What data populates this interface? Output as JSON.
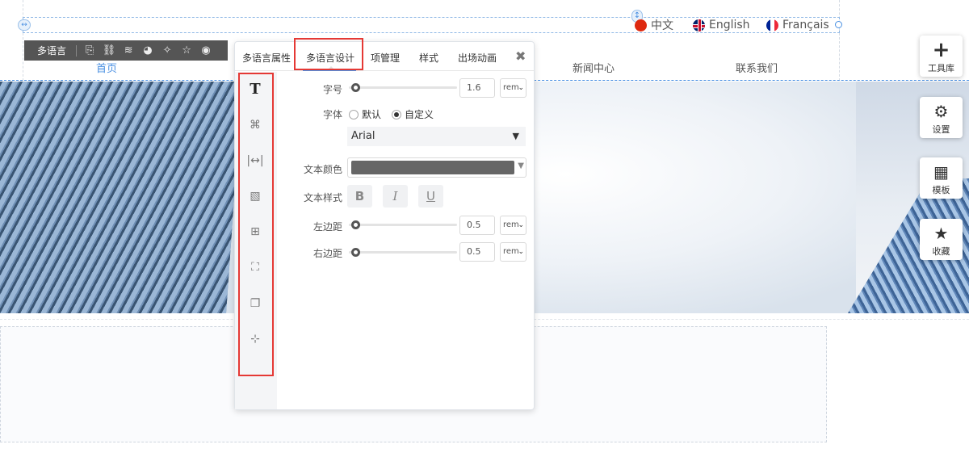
{
  "language_bar": {
    "languages": [
      {
        "label": "中文"
      },
      {
        "label": "English"
      },
      {
        "label": "Français"
      }
    ]
  },
  "nav": {
    "items": [
      "首页",
      "新闻中心",
      "联系我们"
    ]
  },
  "toolbar": {
    "label": "多语言",
    "icons": [
      "page-settings-icon",
      "unlink-icon",
      "layers-icon",
      "palette-icon",
      "magic-wand-icon",
      "star-icon",
      "eye-icon"
    ]
  },
  "panel": {
    "tabs": [
      "多语言属性",
      "多语言设计",
      "项管理",
      "样式",
      "出场动画"
    ],
    "active_tab": "多语言设计",
    "close_label": "✖",
    "side_icons": [
      "text-icon",
      "command-icon",
      "width-icon",
      "pattern-icon",
      "grid-border-icon",
      "corner-frame-icon",
      "shadow-icon",
      "spacing-icon"
    ],
    "font_size": {
      "label": "字号",
      "value": "1.6",
      "unit": "rem",
      "slider_fraction": 0.0
    },
    "font_family": {
      "label": "字体",
      "options": [
        "默认",
        "自定义"
      ],
      "selected": "自定义",
      "font": "Arial"
    },
    "text_color": {
      "label": "文本颜色",
      "value": "#666666"
    },
    "text_style": {
      "label": "文本样式",
      "bold": "B",
      "italic": "I",
      "underline": "U"
    },
    "left_margin": {
      "label": "左边距",
      "value": "0.5",
      "unit": "rem",
      "slider_fraction": 0.0
    },
    "right_margin": {
      "label": "右边距",
      "value": "0.5",
      "unit": "rem",
      "slider_fraction": 0.0
    }
  },
  "dock": [
    {
      "label": "工具库",
      "icon": "plus-icon"
    },
    {
      "label": "设置",
      "icon": "gears-icon"
    },
    {
      "label": "模板",
      "icon": "template-grid-icon"
    },
    {
      "label": "收藏",
      "icon": "star-favorite-icon"
    }
  ],
  "colors": {
    "accent": "#4a90e2",
    "highlight": "#e53935",
    "toolbar": "#555555"
  }
}
